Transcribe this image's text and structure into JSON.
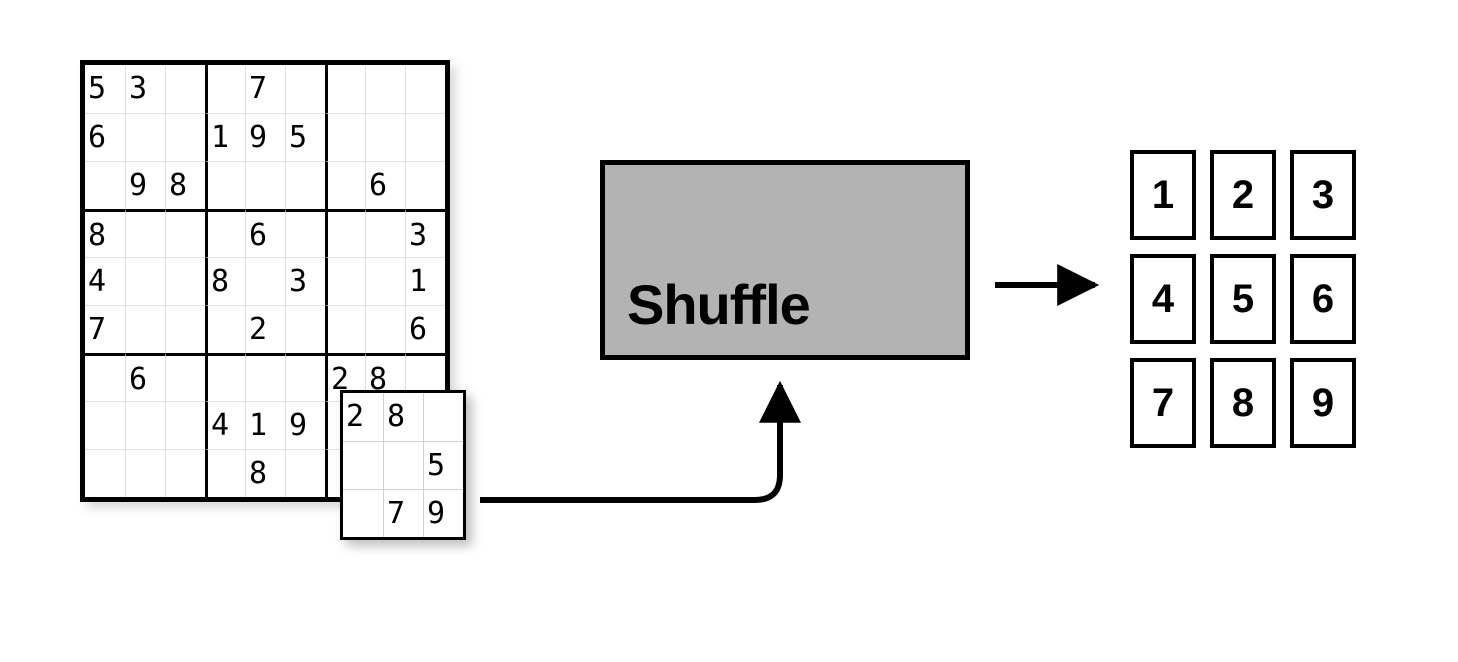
{
  "sudoku": {
    "grid": [
      [
        "5",
        "3",
        "",
        "",
        "7",
        "",
        "",
        "",
        ""
      ],
      [
        "6",
        "",
        "",
        "1",
        "9",
        "5",
        "",
        "",
        ""
      ],
      [
        "",
        "9",
        "8",
        "",
        "",
        "",
        "",
        "6",
        ""
      ],
      [
        "8",
        "",
        "",
        "",
        "6",
        "",
        "",
        "",
        "3"
      ],
      [
        "4",
        "",
        "",
        "8",
        "",
        "3",
        "",
        "",
        "1"
      ],
      [
        "7",
        "",
        "",
        "",
        "2",
        "",
        "",
        "",
        "6"
      ],
      [
        "",
        "6",
        "",
        "",
        "",
        "",
        "2",
        "8",
        ""
      ],
      [
        "",
        "",
        "",
        "4",
        "1",
        "9",
        "",
        "",
        "5"
      ],
      [
        "",
        "",
        "",
        "",
        "8",
        "",
        "",
        "7",
        "9"
      ]
    ],
    "extracted_subgrid": {
      "box_index": 8,
      "cells": [
        [
          "2",
          "8",
          ""
        ],
        [
          "",
          "",
          "5"
        ],
        [
          "",
          "7",
          "9"
        ]
      ]
    }
  },
  "shuffle": {
    "label": "Shuffle"
  },
  "output_keypad": [
    "1",
    "2",
    "3",
    "4",
    "5",
    "6",
    "7",
    "8",
    "9"
  ]
}
